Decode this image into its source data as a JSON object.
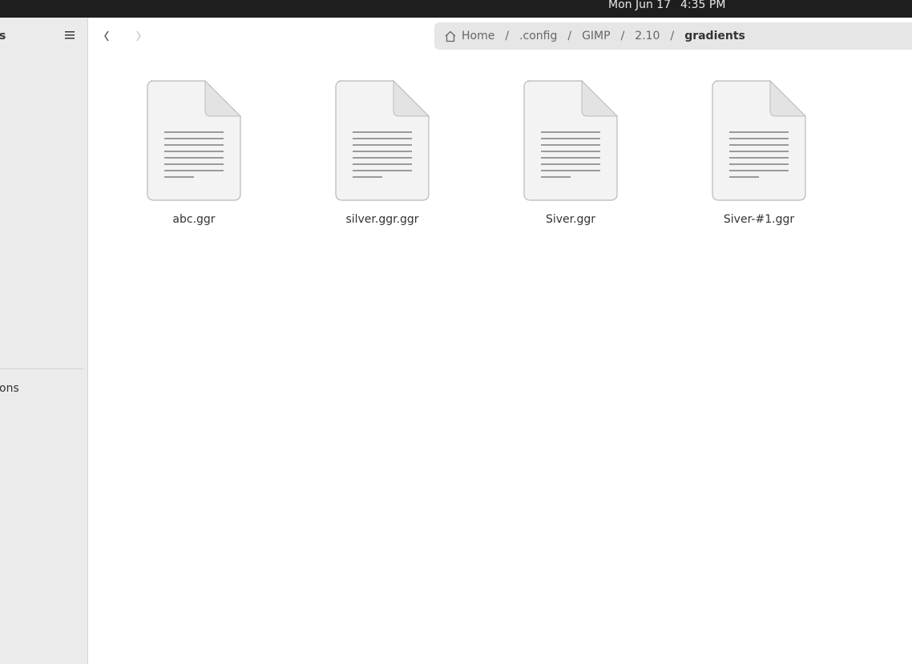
{
  "topbar": {
    "date": "Mon Jun 17",
    "time": "4:35 PM"
  },
  "sidebar": {
    "title_fragment": "s",
    "other_locations_fragment": "ons"
  },
  "nav": {
    "back": "back",
    "forward": "forward"
  },
  "path": {
    "home": "Home",
    "items": [
      ".config",
      "GIMP",
      "2.10"
    ],
    "current": "gradients",
    "separator": "/"
  },
  "files": [
    {
      "name": "abc.ggr",
      "icon": "text-document-icon"
    },
    {
      "name": "silver.ggr.ggr",
      "icon": "text-document-icon"
    },
    {
      "name": "Siver.ggr",
      "icon": "text-document-icon"
    },
    {
      "name": "Siver-#1.ggr",
      "icon": "text-document-icon"
    }
  ]
}
